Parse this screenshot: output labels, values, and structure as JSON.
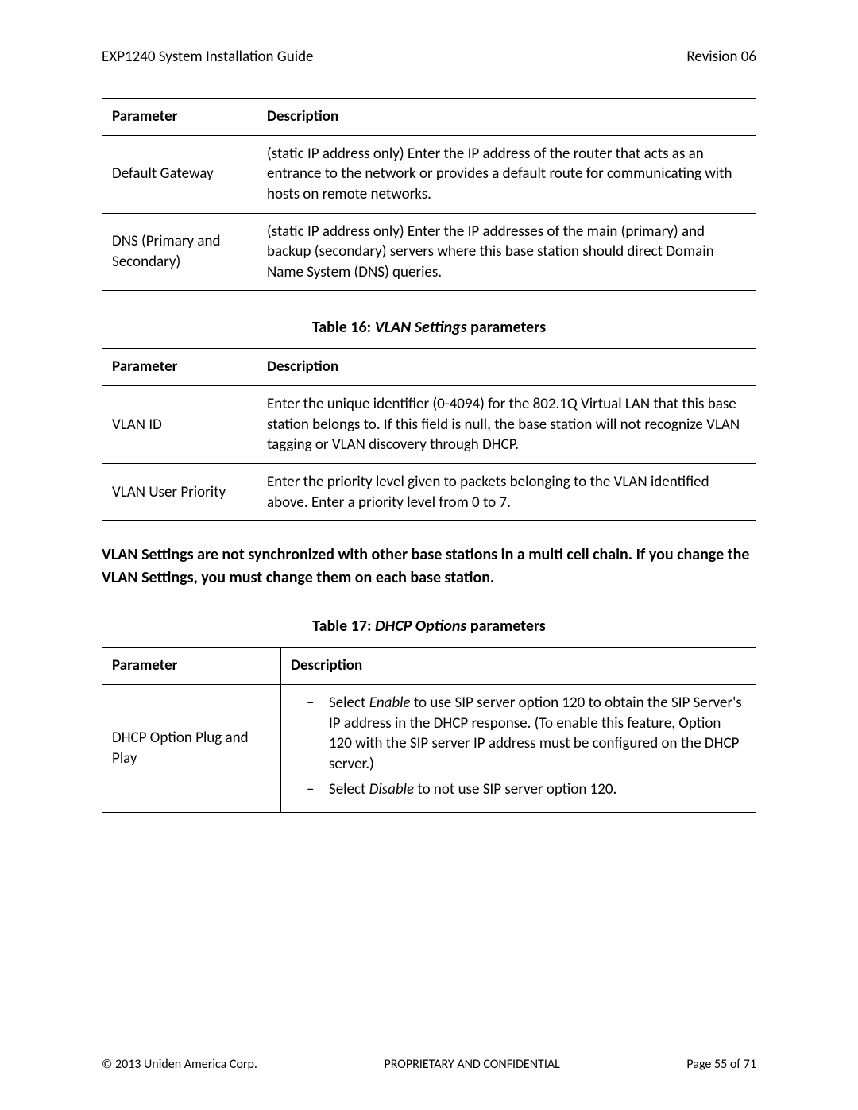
{
  "header": {
    "left": "EXP1240 System Installation Guide",
    "right": "Revision 06"
  },
  "table15": {
    "headers": {
      "param": "Parameter",
      "desc": "Description"
    },
    "rows": [
      {
        "param": "Default Gateway",
        "desc": "(static IP address only) Enter the IP address of the router that acts as an entrance to the network or provides a default route for communicating with hosts on remote networks."
      },
      {
        "param": "DNS (Primary and Secondary)",
        "desc": "(static IP address only) Enter the IP addresses of the main (primary) and backup (secondary) servers where this base station should direct Domain Name System (DNS) queries."
      }
    ]
  },
  "caption16": {
    "prefix": "Table 16: ",
    "title": "VLAN Settings",
    "suffix": " parameters"
  },
  "table16": {
    "headers": {
      "param": "Parameter",
      "desc": "Description"
    },
    "rows": [
      {
        "param": "VLAN ID",
        "desc": "Enter the unique identifier (0-4094) for the 802.1Q Virtual LAN that this base station belongs to. If this field is null, the base station will not recognize VLAN tagging or VLAN discovery through DHCP."
      },
      {
        "param": "VLAN User Priority",
        "desc": "Enter the priority level given to packets belonging to the VLAN identified above. Enter a priority level from 0 to 7."
      }
    ]
  },
  "note_text": "VLAN Settings are not synchronized with other base stations in a multi cell chain. If you change the VLAN Settings, you must change them on each base station.",
  "caption17": {
    "prefix": "Table 17: ",
    "title": "DHCP Options",
    "suffix": " parameters"
  },
  "table17": {
    "headers": {
      "param": "Parameter",
      "desc": "Description"
    },
    "row_param": "DHCP Option Plug and Play",
    "bullets": {
      "b1_pre": "Select ",
      "b1_em": "Enable",
      "b1_post": " to use SIP server option 120 to obtain the SIP Server's IP address in the DHCP response. (To enable this feature, Option 120 with the SIP server IP address must be configured on the DHCP server.)",
      "b2_pre": "Select ",
      "b2_em": "Disable",
      "b2_post": " to not use SIP server option 120."
    }
  },
  "footer": {
    "left": "© 2013 Uniden America Corp.",
    "center": "PROPRIETARY AND CONFIDENTIAL",
    "right": "Page 55 of 71"
  }
}
